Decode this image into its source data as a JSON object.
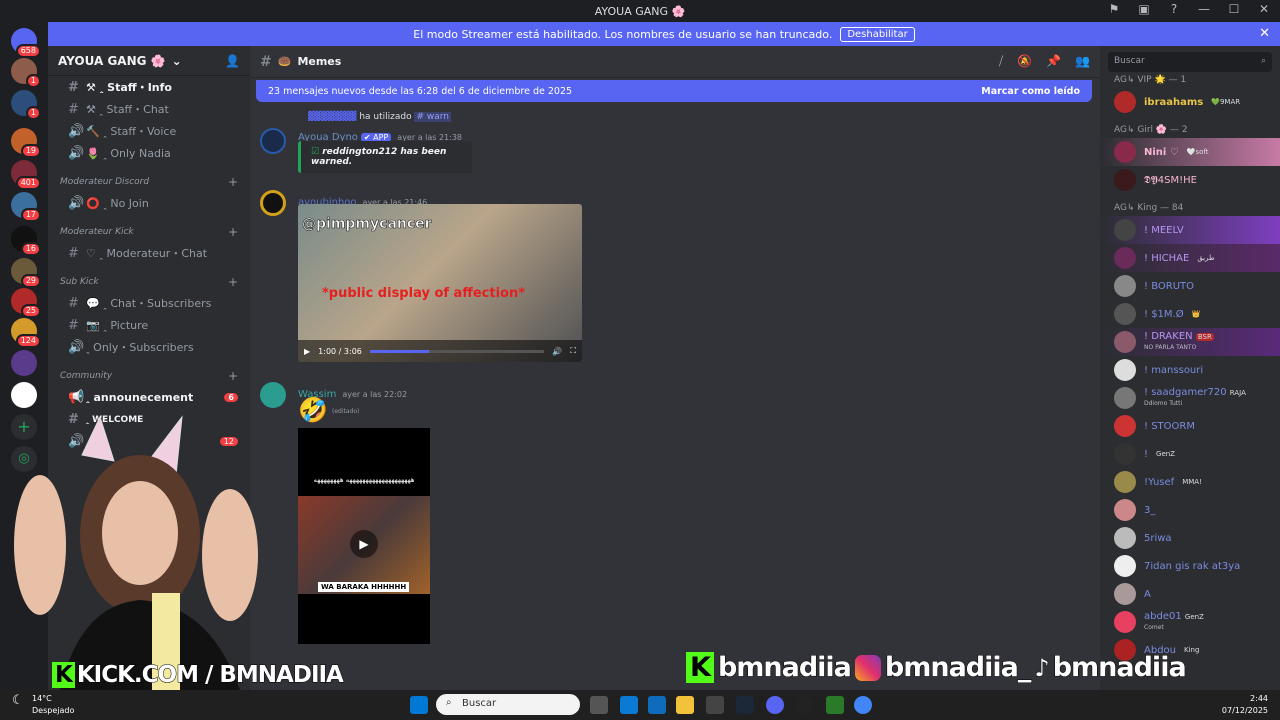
{
  "window": {
    "title": "AYOUA GANG 🌸",
    "controls": [
      "—",
      "☐",
      "✕"
    ]
  },
  "banner": {
    "text": "El modo Streamer está habilitado. Los nombres de usuario se han truncado.",
    "button": "Deshabilitar"
  },
  "guilds": [
    {
      "badge": "658"
    },
    {
      "badge": "1"
    },
    {
      "badge": "1"
    },
    {
      "badge": "19"
    },
    {
      "badge": "401"
    },
    {
      "badge": "17"
    },
    {
      "badge": "16"
    },
    {
      "badge": "29"
    },
    {
      "badge": "25"
    },
    {
      "badge": "124"
    },
    {
      "badge": ""
    },
    {
      "badge": ""
    }
  ],
  "server": {
    "name": "AYOUA GANG 🌸"
  },
  "channels": [
    {
      "icon": "#",
      "label": "⚒ ꞈ Staff・Info",
      "bold": true
    },
    {
      "icon": "#",
      "label": "⚒ ꞈ Staff・Chat"
    },
    {
      "icon": "🔊",
      "label": "🔨 ꞈ Staff・Voice"
    },
    {
      "icon": "🔊",
      "label": "🌷 ꞈ Only Nadia"
    }
  ],
  "cat1": "Moderateur Discord",
  "ch_nojoin": "⭕ ꞈ No Join",
  "cat2": "Moderateur Kick",
  "ch_modchat": "♡ ꞈ Moderateur・Chat",
  "cat3": "Sub Kick",
  "ch_subs": "💬 ꞈ Chat・Subscribers",
  "ch_pic": "📷 ꞈ Picture",
  "ch_onlysub": "ꞈ Only・Subscribers",
  "cat4": "Community",
  "ch_ann": "ꞈ announecement",
  "ch_ann_badge": "6",
  "ch_welcome": "ꞈ WELCOME",
  "ch_extra_badge": "12",
  "chat": {
    "channel": "Memes",
    "newbar": "23 mensajes nuevos desde las 6:28 del 6 de diciembre de 2025",
    "markread": "Marcar como leído",
    "reply_used": "ha utilizado",
    "reply_cmd": "# warn",
    "dyno": {
      "name": "Ayoua Dyno",
      "tag": "✔ APP",
      "time": "ayer a las 21:38",
      "embed": "reddington212 has been warned."
    },
    "msg2": {
      "name": "ayoubinhoo",
      "time": "ayer a las 21:46",
      "video_caption": "@pimpmycancer",
      "video_sub": "*public display of affection*",
      "video_time": "1:00 / 3:06"
    },
    "msg3": {
      "name": "Wassim",
      "time": "ayer a las 22:02",
      "edited": "(editado)",
      "video_caption": "ههههههههههههههههههههه ههههههههه",
      "video_tag": "WA BARAKA HHHHHH"
    }
  },
  "members": {
    "search": "Buscar",
    "groups": [
      {
        "label": "AG↳ VIP 🌟 — 1",
        "items": [
          {
            "name": "ibraahams",
            "tag": "💚9MAR"
          }
        ]
      },
      {
        "label": "AG↳ Girl 🌸 — 2",
        "items": [
          {
            "name": "Nini ♡",
            "tag": "🤍soft"
          },
          {
            "name": "𝕯𝖄4SM!HE",
            "tag": ""
          }
        ]
      },
      {
        "label": "AG↳ King — 84",
        "items": [
          {
            "name": "! MEELV",
            "tag": ""
          },
          {
            "name": "! HICHAE",
            "tag": "طريق"
          },
          {
            "name": "! BORUTO",
            "tag": ""
          },
          {
            "name": "! $1M.Ø",
            "tag": "👑"
          },
          {
            "name": "! DRAKEN",
            "tag": "BSR"
          },
          {
            "name": "! manssouri",
            "tag": ""
          },
          {
            "name": "! saadgamer720",
            "tag": "RAJA"
          },
          {
            "name": "! STOORM",
            "tag": ""
          },
          {
            "name": "!",
            "tag": "GenZ"
          },
          {
            "name": "!Yusef",
            "tag": "MMA!"
          },
          {
            "name": "3_",
            "tag": ""
          },
          {
            "name": "5riwa",
            "tag": ""
          },
          {
            "name": "7idan gis rak at3ya",
            "tag": ""
          },
          {
            "name": "A",
            "tag": ""
          },
          {
            "name": "abde01",
            "tag": "GenZ"
          },
          {
            "name": "Abdou",
            "tag": "King"
          }
        ]
      }
    ],
    "sub_draken": "NO PARLA TANTO",
    "sub_saad": "Ddiomo Tutti",
    "sub_abde": "Comet"
  },
  "overlay": {
    "kick": "KICK.COM / BMNADIIA",
    "social1": "bmnadiia",
    "social2": "bmnadiia_",
    "social3": "bmnadiia"
  },
  "taskbar": {
    "temp": "14°C",
    "weather": "Despejado",
    "search": "Buscar",
    "time": "2:44",
    "date": "07/12/2025"
  }
}
